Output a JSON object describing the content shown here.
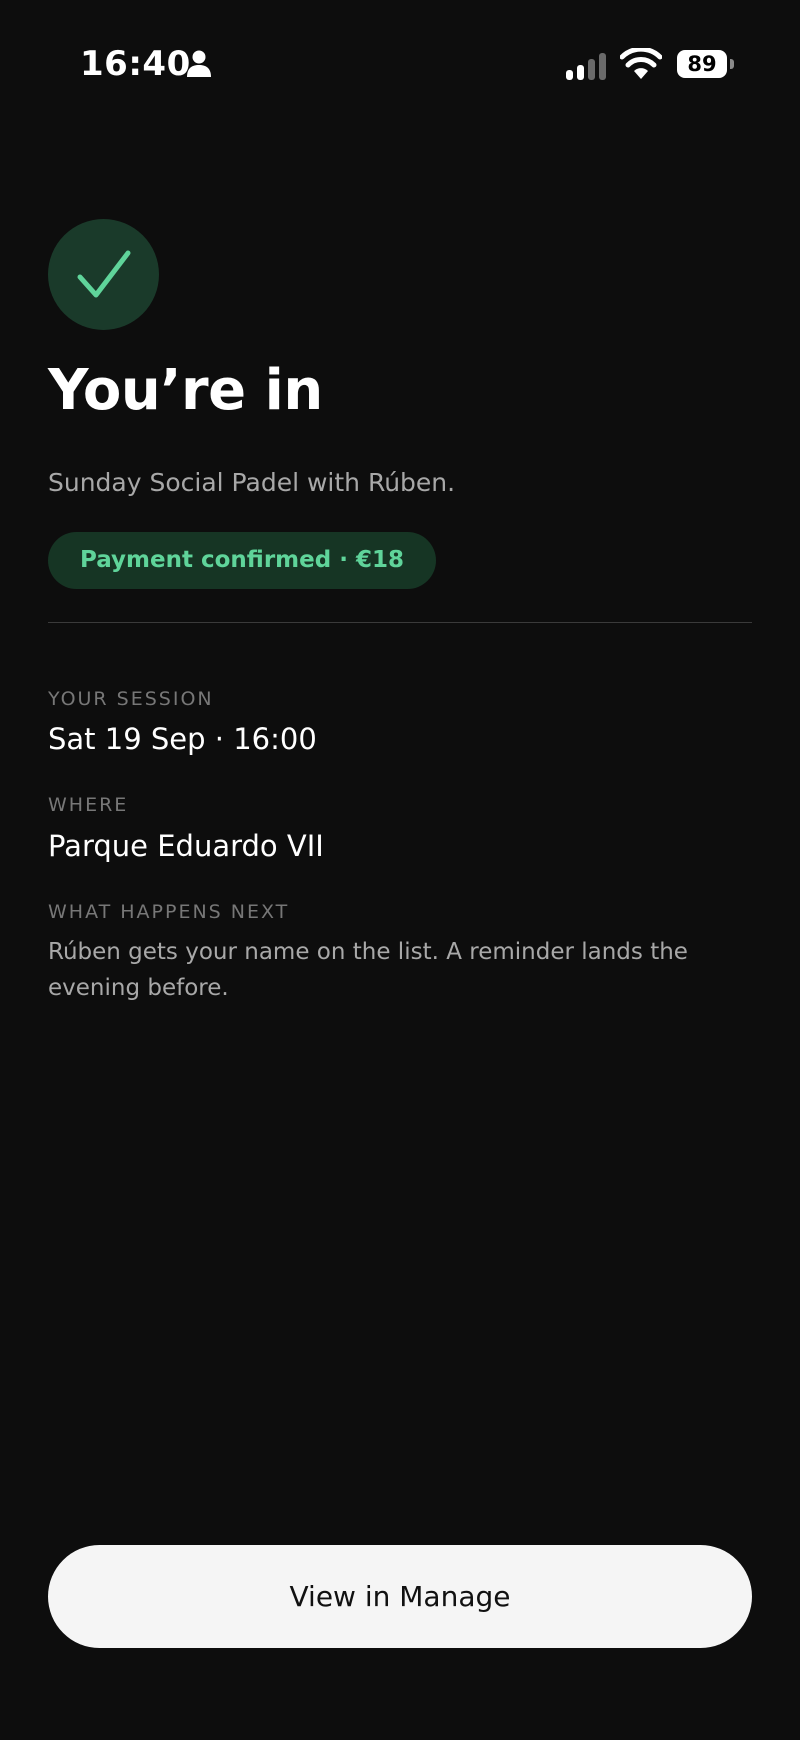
{
  "status_bar": {
    "time": "16:40",
    "battery_level": "89"
  },
  "confirmation": {
    "title": "You’re in",
    "subtitle": "Sunday Social Padel with Rúben.",
    "payment_badge": "Payment confirmed · €18"
  },
  "details": {
    "session_label": "YOUR SESSION",
    "session_value": "Sat 19 Sep · 16:00",
    "where_label": "WHERE",
    "where_value": "Parque Eduardo VII",
    "next_label": "WHAT HAPPENS NEXT",
    "next_text": "Rúben gets your name on the list. A reminder lands the evening before."
  },
  "actions": {
    "view_manage_label": "View in Manage"
  },
  "colors": {
    "background": "#0d0d0d",
    "accent_green": "#5fd49a",
    "badge_background": "#163524",
    "button_background": "#f5f5f5"
  }
}
